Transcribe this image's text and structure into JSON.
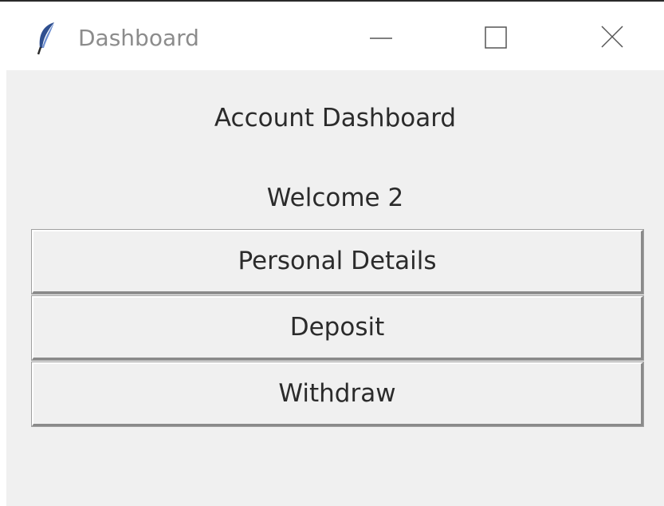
{
  "window": {
    "title": "Dashboard",
    "icons": {
      "app": "feather-icon",
      "minimize": "minimize-icon",
      "maximize": "maximize-icon",
      "close": "close-icon"
    }
  },
  "main": {
    "heading": "Account Dashboard",
    "welcome": "Welcome 2",
    "buttons": {
      "personal_details": "Personal Details",
      "deposit": "Deposit",
      "withdraw": "Withdraw"
    }
  },
  "colors": {
    "window_background": "#f0f0f0",
    "titlebar_background": "#ffffff",
    "title_text": "#8c8c8c",
    "body_text": "#2b2b2b",
    "feather_blue": "#2f4f8f"
  }
}
